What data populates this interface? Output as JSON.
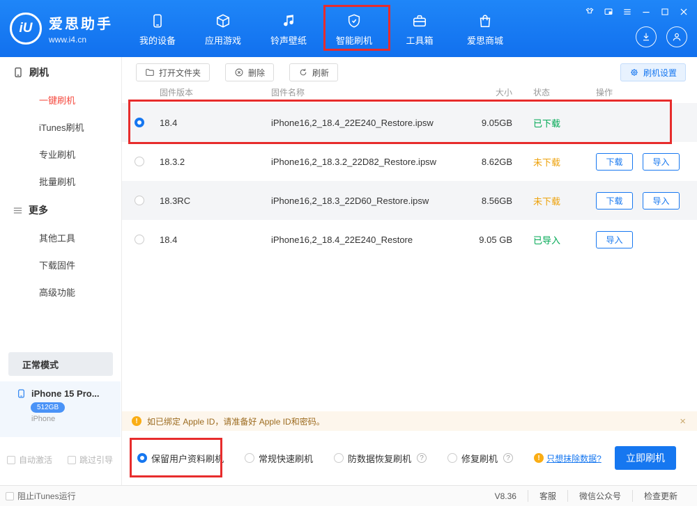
{
  "colors": {
    "accent": "#1677f0",
    "green": "#00a854",
    "warning_orange": "#eda20c",
    "annotation_red": "#e72c2c"
  },
  "header": {
    "logo": {
      "mark": "iU",
      "title": "爱思助手",
      "subtitle": "www.i4.cn"
    },
    "nav": [
      {
        "label": "我的设备"
      },
      {
        "label": "应用游戏"
      },
      {
        "label": "铃声壁纸"
      },
      {
        "label": "智能刷机"
      },
      {
        "label": "工具箱"
      },
      {
        "label": "爱思商城"
      }
    ]
  },
  "sidebar": {
    "sections": [
      {
        "title": "刷机",
        "items": [
          {
            "label": "一键刷机"
          },
          {
            "label": "iTunes刷机"
          },
          {
            "label": "专业刷机"
          },
          {
            "label": "批量刷机"
          }
        ]
      },
      {
        "title": "更多",
        "items": [
          {
            "label": "其他工具"
          },
          {
            "label": "下载固件"
          },
          {
            "label": "高级功能"
          }
        ]
      }
    ],
    "mode_label": "正常模式",
    "device": {
      "name": "iPhone 15 Pro...",
      "storage": "512GB",
      "type": "iPhone"
    },
    "checks": [
      {
        "label": "自动激活"
      },
      {
        "label": "跳过引导"
      }
    ]
  },
  "toolbar": {
    "open_folder": "打开文件夹",
    "delete": "删除",
    "refresh": "刷新",
    "settings": "刷机设置"
  },
  "table": {
    "columns": [
      "固件版本",
      "固件名称",
      "大小",
      "状态",
      "操作"
    ],
    "rows": [
      {
        "version": "18.4",
        "name": "iPhone16,2_18.4_22E240_Restore.ipsw",
        "size": "9.05GB",
        "status": "已下载",
        "actions": []
      },
      {
        "version": "18.3.2",
        "name": "iPhone16,2_18.3.2_22D82_Restore.ipsw",
        "size": "8.62GB",
        "status": "未下载",
        "actions": [
          "下载",
          "导入"
        ]
      },
      {
        "version": "18.3RC",
        "name": "iPhone16,2_18.3_22D60_Restore.ipsw",
        "size": "8.56GB",
        "status": "未下载",
        "actions": [
          "下载",
          "导入"
        ]
      },
      {
        "version": "18.4",
        "name": "iPhone16,2_18.4_22E240_Restore",
        "size": "9.05 GB",
        "status": "已导入",
        "actions": [
          "导入"
        ]
      }
    ]
  },
  "notice": {
    "icon_glyph": "!",
    "text": "如已绑定 Apple ID，请准备好 Apple ID和密码。",
    "close": "×"
  },
  "options": {
    "items": [
      {
        "label": "保留用户资料刷机"
      },
      {
        "label": "常规快速刷机"
      },
      {
        "label": "防数据恢复刷机"
      },
      {
        "label": "修复刷机"
      }
    ],
    "help_glyph": "?",
    "warn_glyph": "!",
    "erase_link": "只想抹除数据?",
    "flash_button": "立即刷机"
  },
  "statusbar": {
    "block_itunes": "阻止iTunes运行",
    "version": "V8.36",
    "links": [
      {
        "label": "客服"
      },
      {
        "label": "微信公众号"
      },
      {
        "label": "检查更新"
      }
    ]
  }
}
